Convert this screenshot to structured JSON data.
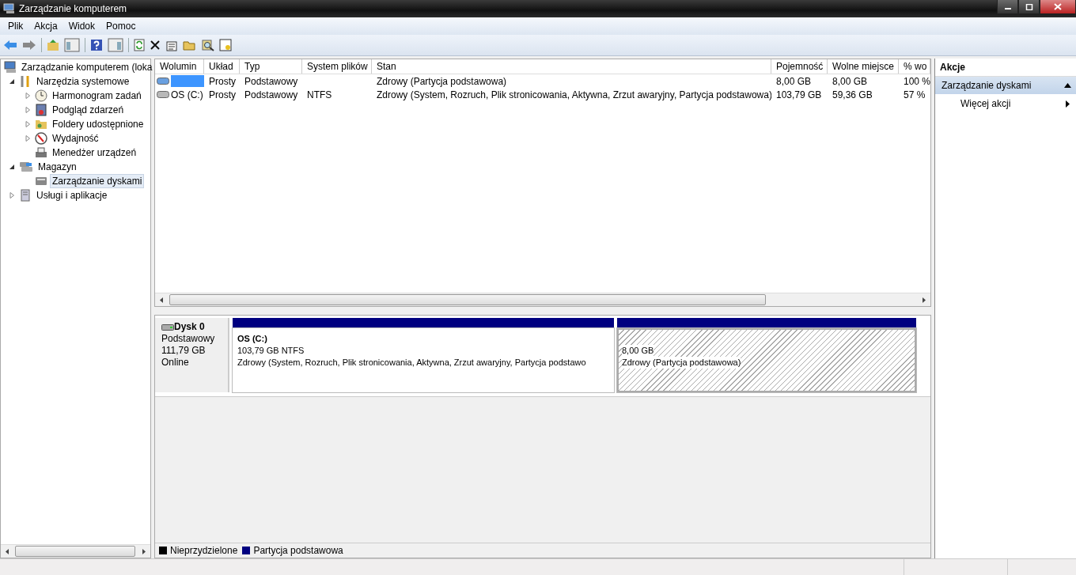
{
  "window": {
    "title": "Zarządzanie komputerem"
  },
  "menu": [
    "Plik",
    "Akcja",
    "Widok",
    "Pomoc"
  ],
  "tree": [
    {
      "label": "Zarządzanie komputerem (loka",
      "selected": false,
      "children": [
        {
          "label": "Narzędzia systemowe",
          "expandable": true,
          "expanded": true,
          "selected": false,
          "children": [
            {
              "label": "Harmonogram zadań",
              "expandable": true,
              "expanded": false,
              "selected": false
            },
            {
              "label": "Podgląd zdarzeń",
              "expandable": true,
              "expanded": false,
              "selected": false
            },
            {
              "label": "Foldery udostępnione",
              "expandable": true,
              "expanded": false,
              "selected": false
            },
            {
              "label": "Wydajność",
              "expandable": true,
              "expanded": false,
              "selected": false
            },
            {
              "label": "Menedżer urządzeń",
              "selected": false
            }
          ]
        },
        {
          "label": "Magazyn",
          "expandable": true,
          "expanded": true,
          "selected": false,
          "children": [
            {
              "label": "Zarządzanie dyskami",
              "selected": true
            }
          ]
        },
        {
          "label": "Usługi i aplikacje",
          "expandable": true,
          "expanded": false,
          "selected": false
        }
      ]
    }
  ],
  "volumes": {
    "columns": [
      "Wolumin",
      "Układ",
      "Typ",
      "System plików",
      "Stan",
      "Pojemność",
      "Wolne miejsce",
      "% wo"
    ],
    "rows": [
      {
        "redacted": true,
        "cells": [
          "",
          "Prosty",
          "Podstawowy",
          "",
          "Zdrowy (Partycja podstawowa)",
          "8,00 GB",
          "8,00 GB",
          "100 %"
        ]
      },
      {
        "redacted": false,
        "cells": [
          "OS (C:)",
          "Prosty",
          "Podstawowy",
          "NTFS",
          "Zdrowy (System, Rozruch, Plik stronicowania, Aktywna, Zrzut awaryjny, Partycja podstawowa)",
          "103,79 GB",
          "59,36 GB",
          "57 %"
        ]
      }
    ]
  },
  "disk": {
    "name": "Dysk 0",
    "type": "Podstawowy",
    "size": "111,79 GB",
    "status": "Online",
    "partitions": [
      {
        "name": "OS  (C:)",
        "size": "103,79 GB NTFS",
        "status": "Zdrowy (System, Rozruch, Plik stronicowania, Aktywna, Zrzut awaryjny, Partycja podstawo",
        "selected": false
      },
      {
        "size": "8,00 GB",
        "status": "Zdrowy (Partycja podstawowa)",
        "selected": true
      }
    ]
  },
  "legend": [
    {
      "label": "Nieprzydzielone",
      "color": "#000000"
    },
    {
      "label": "Partycja podstawowa",
      "color": "#000080"
    }
  ],
  "actions": {
    "title": "Akcje",
    "section": "Zarządzanie dyskami",
    "items": [
      "Więcej akcji"
    ]
  }
}
